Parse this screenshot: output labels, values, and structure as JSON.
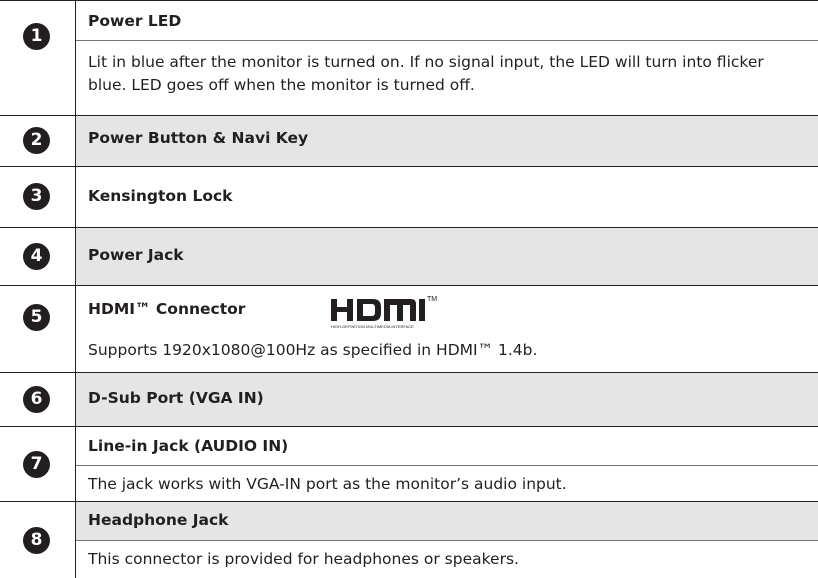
{
  "items": [
    {
      "number": "1",
      "title": "Power LED",
      "description": "Lit in blue after the monitor is turned on. If no signal input, the LED will turn into flicker blue. LED goes off when the monitor is turned off."
    },
    {
      "number": "2",
      "title": "Power Button & Navi Key"
    },
    {
      "number": "3",
      "title": "Kensington Lock"
    },
    {
      "number": "4",
      "title": "Power Jack"
    },
    {
      "number": "5",
      "title": "HDMI™ Connector",
      "description": "Supports 1920x1080@100Hz as specified in HDMI™ 1.4b.",
      "logo": {
        "text": "HDMI",
        "tagline": "HIGH-DEFINITION MULTIMEDIA INTERFACE",
        "tm": "TM"
      }
    },
    {
      "number": "6",
      "title": "D-Sub Port (VGA IN)"
    },
    {
      "number": "7",
      "title": "Line-in Jack (AUDIO IN)",
      "description": "The jack works with VGA-IN port as the monitor’s audio input."
    },
    {
      "number": "8",
      "title": "Headphone Jack",
      "description": "This connector is provided for headphones or speakers."
    }
  ]
}
